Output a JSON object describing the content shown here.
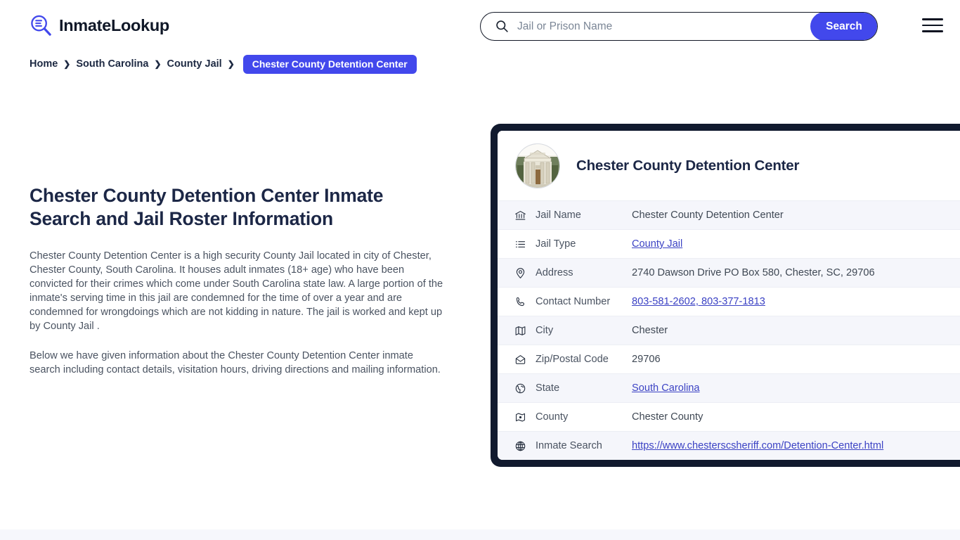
{
  "header": {
    "brand_name": "InmateLookup",
    "logo_icon": "magnifier-list-icon",
    "menu_icon": "hamburger-menu-icon"
  },
  "search": {
    "icon": "search-icon",
    "placeholder": "Jail or Prison Name",
    "value": "",
    "button_label": "Search"
  },
  "breadcrumb": {
    "items": [
      {
        "label": "Home"
      },
      {
        "label": "South Carolina"
      },
      {
        "label": "County Jail"
      }
    ],
    "separator": "❯",
    "current": "Chester County Detention Center"
  },
  "main": {
    "title": "Chester County Detention Center Inmate Search and Jail Roster Information",
    "paragraph1": "Chester County Detention Center is a high security County Jail located in city of Chester, Chester County, South Carolina. It houses adult inmates (18+ age) who have been convicted for their crimes which come under South Carolina state law. A large portion of the inmate's serving time in this jail are condemned for the time of over a year and are condemned for wrongdoings which are not kidding in nature. The jail is worked and kept up by County Jail .",
    "paragraph2": "Below we have given information about the Chester County Detention Center inmate search including contact details, visitation hours, driving directions and mailing information."
  },
  "card": {
    "avatar_icon": "courthouse-photo",
    "title": "Chester County Detention Center",
    "rows": [
      {
        "icon": "bank-icon",
        "label": "Jail Name",
        "value": "Chester County Detention Center",
        "link": false
      },
      {
        "icon": "list-icon",
        "label": "Jail Type",
        "value": "County Jail",
        "link": true
      },
      {
        "icon": "map-pin-icon",
        "label": "Address",
        "value": "2740 Dawson Drive PO Box 580, Chester, SC, 29706",
        "link": false
      },
      {
        "icon": "phone-icon",
        "label": "Contact Number",
        "value": "803-581-2602, 803-377-1813",
        "link": true
      },
      {
        "icon": "map-icon",
        "label": "City",
        "value": "Chester",
        "link": false
      },
      {
        "icon": "envelope-icon",
        "label": "Zip/Postal Code",
        "value": "29706",
        "link": false
      },
      {
        "icon": "globe-icon",
        "label": "State",
        "value": "South Carolina",
        "link": true
      },
      {
        "icon": "map-marked-icon",
        "label": "County",
        "value": "Chester County",
        "link": false
      },
      {
        "icon": "globe-grid-icon",
        "label": "Inmate Search",
        "value": "https://www.chesterscsheriff.com/Detention-Center.html",
        "link": true
      }
    ]
  },
  "colors": {
    "accent": "#4248ec",
    "link": "#3b42c4",
    "card_border": "#111a2e",
    "heading": "#1c2746",
    "row_alt": "#f5f6fb"
  }
}
